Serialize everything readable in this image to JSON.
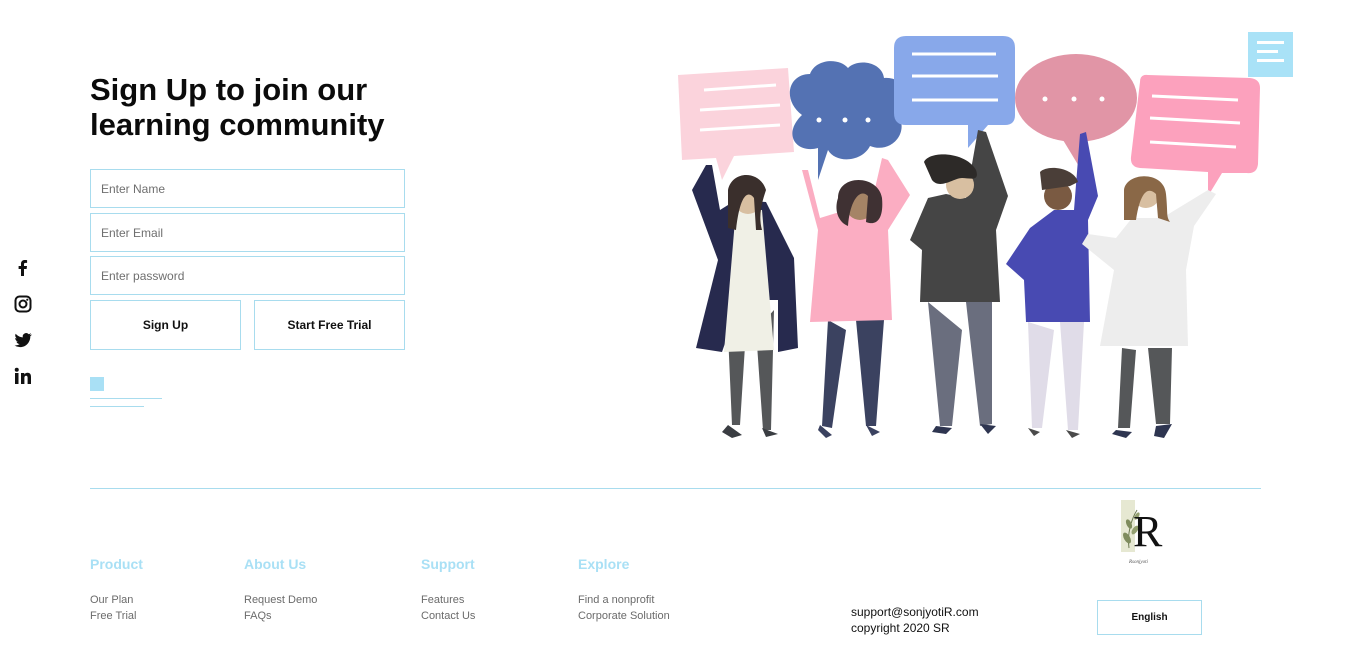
{
  "social": {
    "icons": [
      "facebook-icon",
      "instagram-icon",
      "twitter-icon",
      "linkedin-icon"
    ]
  },
  "hero": {
    "headline": "Sign Up to join our learning community",
    "name_placeholder": "Enter Name",
    "email_placeholder": "Enter Email",
    "password_placeholder": "Enter password",
    "signup_label": "Sign Up",
    "trial_label": "Start Free Trial"
  },
  "footer": {
    "columns": [
      {
        "title": "Product",
        "links": [
          "Our Plan",
          "Free Trial"
        ]
      },
      {
        "title": "About Us",
        "links": [
          "Request Demo",
          "FAQs"
        ]
      },
      {
        "title": "Support",
        "links": [
          "Features",
          "Contact Us"
        ]
      },
      {
        "title": "Explore",
        "links": [
          "Find a nonprofit",
          "Corporate Solution"
        ]
      }
    ],
    "email": "support@sonjyotiR.com",
    "copyright": "copyright 2020 SR",
    "language": "English",
    "logo_letter": "R",
    "logo_signature": "Rsonjyoti"
  },
  "colors": {
    "accent": "#a9e0f5",
    "border": "#a8dcee",
    "heading": "#0b0b0b",
    "link": "#6b6b6b"
  }
}
